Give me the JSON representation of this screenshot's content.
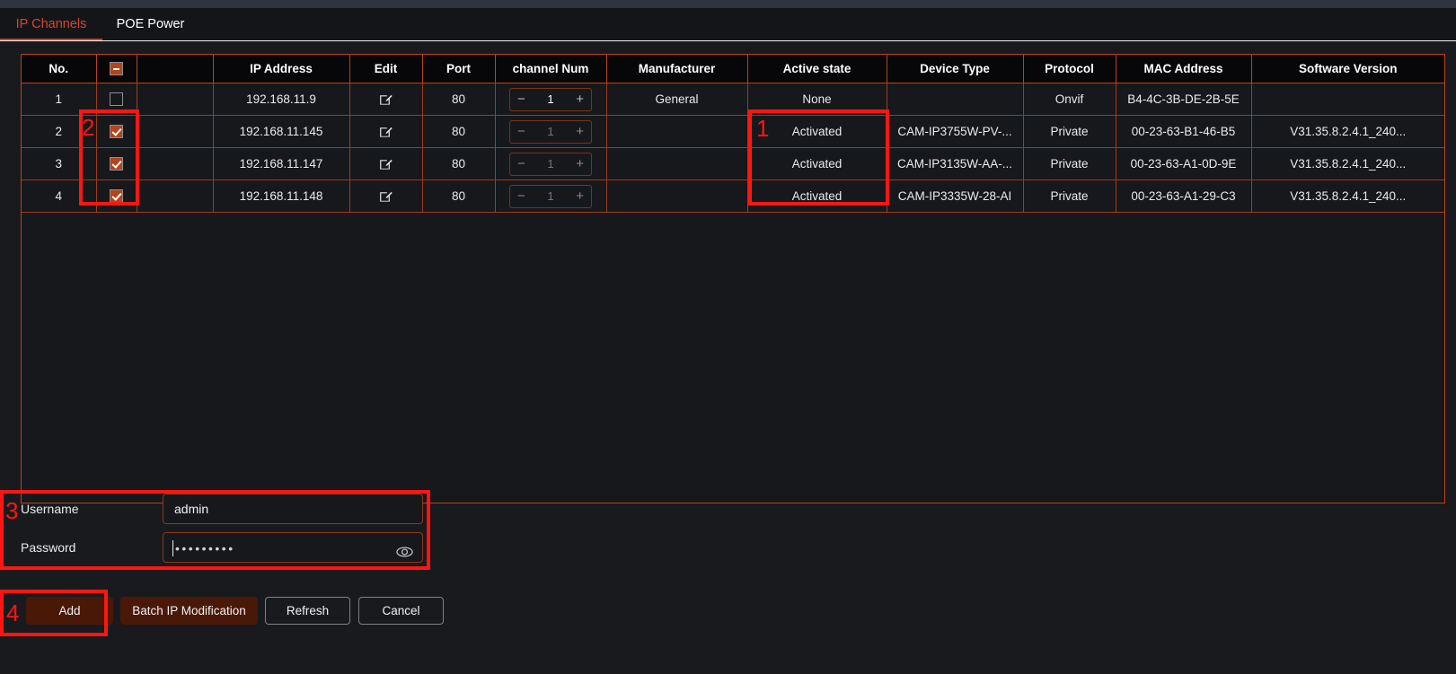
{
  "window": {
    "chrome_color": "#2e3440",
    "background_color": "#191a1e",
    "accent_color": "#b8441c",
    "annotation_color": "#ff1612"
  },
  "tabs": [
    {
      "label": "IP Channels",
      "active": true
    },
    {
      "label": "POE Power",
      "active": false
    }
  ],
  "table": {
    "columns": [
      {
        "key": "no",
        "label": "No."
      },
      {
        "key": "select",
        "label": "",
        "icon": "select-all-minus-icon"
      },
      {
        "key": "blank",
        "label": ""
      },
      {
        "key": "ip",
        "label": "IP Address"
      },
      {
        "key": "edit",
        "label": "Edit"
      },
      {
        "key": "port",
        "label": "Port"
      },
      {
        "key": "chnum",
        "label": "channel Num"
      },
      {
        "key": "manufacturer",
        "label": "Manufacturer"
      },
      {
        "key": "active",
        "label": "Active state"
      },
      {
        "key": "devtype",
        "label": "Device Type"
      },
      {
        "key": "protocol",
        "label": "Protocol"
      },
      {
        "key": "mac",
        "label": "MAC Address"
      },
      {
        "key": "swver",
        "label": "Software Version"
      }
    ],
    "rows": [
      {
        "no": "1",
        "checked": false,
        "ip": "192.168.11.9",
        "edit_icon": "edit-pencil-icon",
        "port": "80",
        "chnum": "1",
        "chnum_bright": true,
        "manufacturer": "General",
        "active": "None",
        "devtype": "",
        "protocol": "Onvif",
        "mac": "B4-4C-3B-DE-2B-5E",
        "swver": ""
      },
      {
        "no": "2",
        "checked": true,
        "ip": "192.168.11.145",
        "edit_icon": "edit-pencil-icon",
        "port": "80",
        "chnum": "1",
        "chnum_bright": false,
        "manufacturer": "",
        "active": "Activated",
        "devtype": "CAM-IP3755W-PV-...",
        "protocol": "Private",
        "mac": "00-23-63-B1-46-B5",
        "swver": "V31.35.8.2.4.1_240..."
      },
      {
        "no": "3",
        "checked": true,
        "ip": "192.168.11.147",
        "edit_icon": "edit-pencil-icon",
        "port": "80",
        "chnum": "1",
        "chnum_bright": false,
        "manufacturer": "",
        "active": "Activated",
        "devtype": "CAM-IP3135W-AA-...",
        "protocol": "Private",
        "mac": "00-23-63-A1-0D-9E",
        "swver": "V31.35.8.2.4.1_240..."
      },
      {
        "no": "4",
        "checked": true,
        "ip": "192.168.11.148",
        "edit_icon": "edit-pencil-icon",
        "port": "80",
        "chnum": "1",
        "chnum_bright": false,
        "manufacturer": "",
        "active": "Activated",
        "devtype": "CAM-IP3335W-28-AI",
        "protocol": "Private",
        "mac": "00-23-63-A1-29-C3",
        "swver": "V31.35.8.2.4.1_240..."
      }
    ]
  },
  "form": {
    "username_label": "Username",
    "username_value": "admin",
    "username_placeholder": "",
    "password_label": "Password",
    "password_value": "•••••••••",
    "password_placeholder": "",
    "password_reveal_icon": "eye-icon"
  },
  "buttons": [
    {
      "label": "Add",
      "style": "primary"
    },
    {
      "label": "Batch IP Modification",
      "style": "primary"
    },
    {
      "label": "Refresh",
      "style": "ghost"
    },
    {
      "label": "Cancel",
      "style": "ghost"
    }
  ],
  "annotations": [
    {
      "number": "1",
      "target": "active-state-column"
    },
    {
      "number": "2",
      "target": "row-checkbox-column"
    },
    {
      "number": "3",
      "target": "credentials-form"
    },
    {
      "number": "4",
      "target": "add-button"
    }
  ]
}
